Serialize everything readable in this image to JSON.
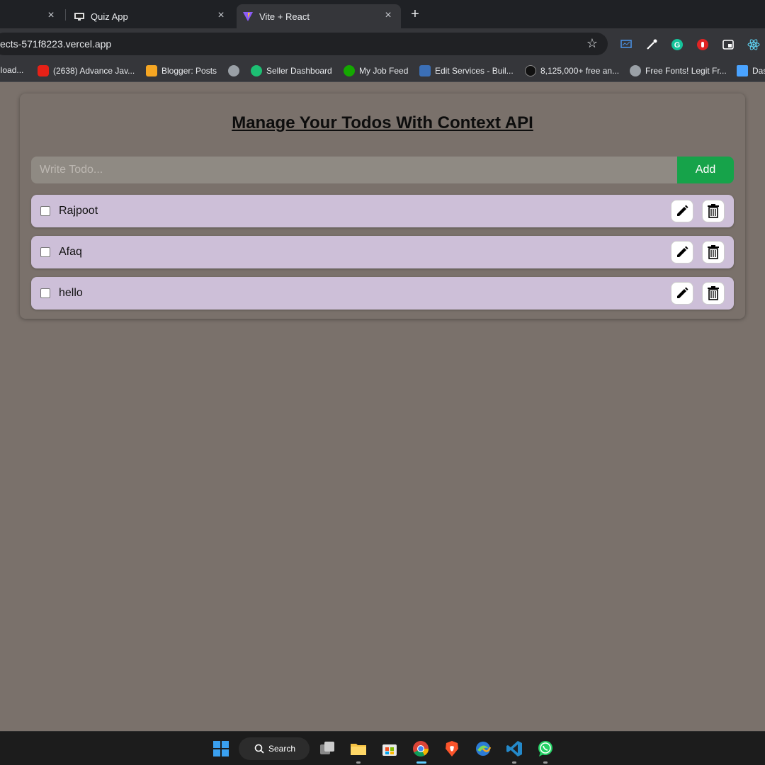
{
  "browser": {
    "tabs": [
      {
        "label": "",
        "close": "×"
      },
      {
        "label": "Quiz App",
        "close": "×"
      },
      {
        "label": "Vite + React",
        "close": "×"
      }
    ],
    "new_tab": "+",
    "url": "ects-571f8223.vercel.app",
    "star": "☆",
    "bookmarks": [
      {
        "label": "nload...",
        "color": "#f29900"
      },
      {
        "label": "(2638) Advance Jav...",
        "color": "#e62117"
      },
      {
        "label": "Blogger: Posts",
        "color": "#f5a623"
      },
      {
        "label": "",
        "color": "#9aa0a6"
      },
      {
        "label": "Seller Dashboard",
        "color": "#1dbf73"
      },
      {
        "label": "My Job Feed",
        "color": "#14a800"
      },
      {
        "label": "Edit Services - Buil...",
        "color": "#3b6fb6"
      },
      {
        "label": "8,125,000+ free an...",
        "color": "#111111"
      },
      {
        "label": "Free Fonts! Legit Fr...",
        "color": "#9aa0a6"
      },
      {
        "label": "Das",
        "color": "#4aa3ff"
      }
    ],
    "extensions": [
      "screen-monitor-icon",
      "picker-icon",
      "grammarly-icon",
      "adblock-icon",
      "window-icon",
      "react-devtools-icon"
    ]
  },
  "app": {
    "title": "Manage Your Todos With Context API",
    "input_placeholder": "Write Todo...",
    "add_label": "Add",
    "todos": [
      {
        "text": "Rajpoot",
        "done": false
      },
      {
        "text": "Afaq",
        "done": false
      },
      {
        "text": "hello",
        "done": false
      }
    ],
    "colors": {
      "background": "#7a716b",
      "todo_bg": "#cdbfd8",
      "add_button": "#16a34a"
    }
  },
  "taskbar": {
    "search_label": "Search",
    "apps": [
      "windows-start-icon",
      "task-view-icon",
      "file-explorer-icon",
      "microsoft-store-icon",
      "chrome-icon",
      "brave-icon",
      "edge-dev-icon",
      "vscode-icon",
      "whatsapp-icon"
    ]
  }
}
